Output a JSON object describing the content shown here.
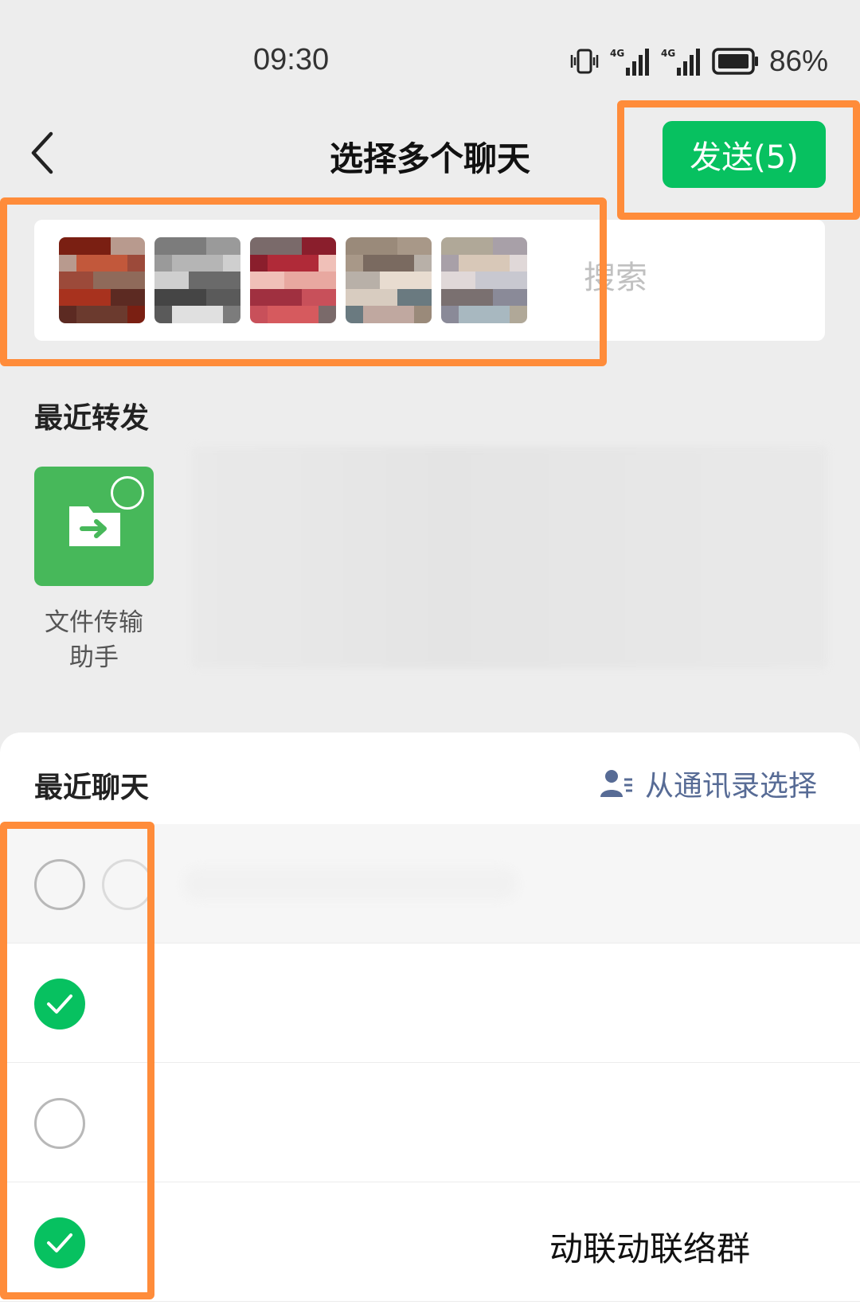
{
  "status_bar": {
    "time": "09:30",
    "signal_label_1": "4G",
    "signal_label_2": "4G",
    "battery": "86%"
  },
  "header": {
    "title": "选择多个聊天",
    "send_label": "发送(5)"
  },
  "selected_bar": {
    "search_placeholder": "搜索"
  },
  "recent_forward": {
    "title": "最近转发",
    "items": [
      {
        "label": "文件传输助手"
      }
    ]
  },
  "recent_chats": {
    "title": "最近聊天",
    "contacts_link": "从通讯录选择",
    "rows": [
      {
        "checked": false,
        "name": ""
      },
      {
        "checked": true,
        "name": ""
      },
      {
        "checked": false,
        "name": ""
      },
      {
        "checked": true,
        "name": "动联动联络群"
      }
    ]
  },
  "colors": {
    "accent": "#07c160",
    "link": "#576b95",
    "highlight": "#ff8c3a",
    "background": "#ededed"
  }
}
